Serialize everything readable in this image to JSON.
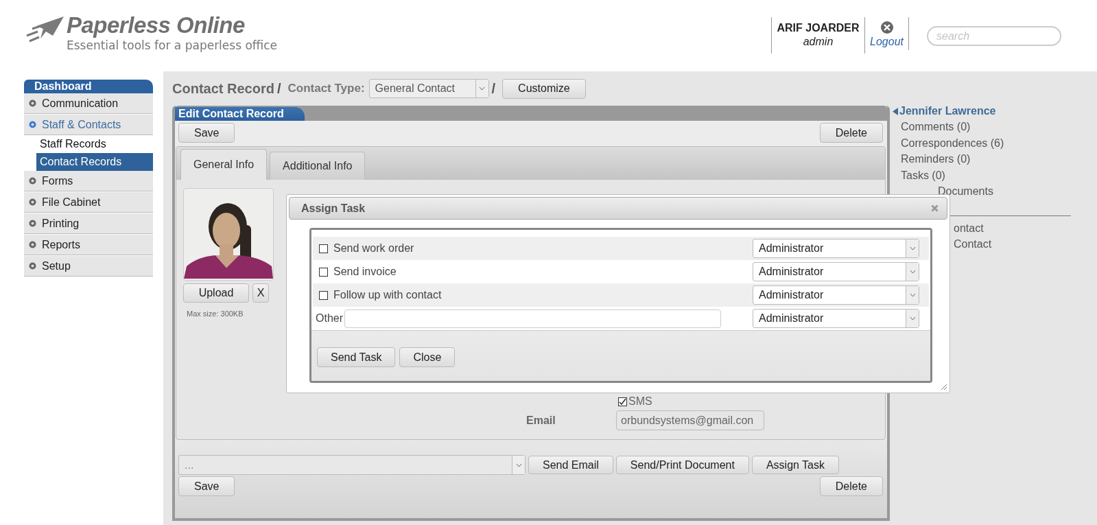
{
  "header": {
    "logo": {
      "title": "Paperless Online",
      "tagline": "Essential tools for a paperless office"
    },
    "user": {
      "name": "ARIF JOARDER",
      "role": "admin"
    },
    "logout": {
      "label": "Logout"
    },
    "search": {
      "placeholder": "search"
    }
  },
  "sidebar": {
    "title": "Dashboard",
    "items": [
      {
        "label": "Communication",
        "selected": false
      },
      {
        "label": "Staff & Contacts",
        "selected": true,
        "children": [
          {
            "label": "Staff Records",
            "selected": false
          },
          {
            "label": "Contact Records",
            "selected": true
          }
        ]
      },
      {
        "label": "Forms",
        "selected": false
      },
      {
        "label": "File Cabinet",
        "selected": false
      },
      {
        "label": "Printing",
        "selected": false
      },
      {
        "label": "Reports",
        "selected": false
      },
      {
        "label": "Setup",
        "selected": false
      }
    ]
  },
  "breadcrumb": {
    "title": "Contact Record",
    "separator_1": "/",
    "type_label": "Contact Type:",
    "type_value": "General Contact",
    "separator_2": "/",
    "customize": "Customize"
  },
  "panel": {
    "title": "Edit Contact Record",
    "save_top": "Save",
    "delete_top": "Delete",
    "tabs": [
      {
        "label": "General Info",
        "selected": true
      },
      {
        "label": "Additional Info",
        "selected": false
      }
    ],
    "photo": {
      "kind": "picture"
    },
    "upload": "Upload",
    "remove": "X",
    "max_size": "Max size: 300KB",
    "sms": {
      "label": "SMS",
      "checked": true
    },
    "email": {
      "label": "Email",
      "value": "orbundsystems@gmail.con"
    },
    "template_select": {
      "value": "..."
    },
    "actions": [
      "Send Email",
      "Send/Print Document",
      "Assign Task"
    ],
    "save_bottom": "Save",
    "delete_bottom": "Delete"
  },
  "contact_links": {
    "name": "Jennifer Lawrence",
    "items": [
      "Comments (0)",
      "Correspondences (6)",
      "Reminders (0)",
      "Tasks (0)",
      "Documents"
    ],
    "more": [
      "ontact",
      "Contact"
    ]
  },
  "modal": {
    "title": "Assign Task",
    "rows": [
      {
        "kind": "checkbox",
        "label": "Send work order",
        "checked": false,
        "assignee": "Administrator"
      },
      {
        "kind": "checkbox",
        "label": "Send invoice",
        "checked": false,
        "assignee": "Administrator"
      },
      {
        "kind": "checkbox",
        "label": "Follow up with contact",
        "checked": false,
        "assignee": "Administrator"
      },
      {
        "kind": "other",
        "label": "Other",
        "assignee": "Administrator"
      }
    ],
    "buttons": [
      "Send Task",
      "Close"
    ]
  }
}
